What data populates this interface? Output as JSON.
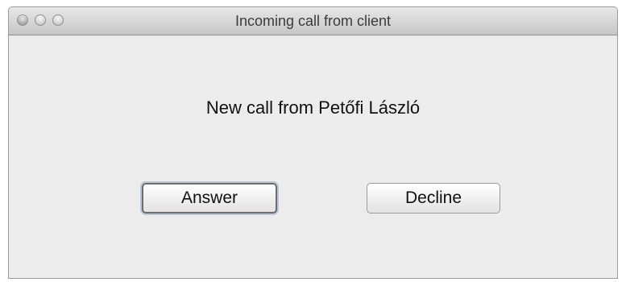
{
  "window": {
    "title": "Incoming call from client"
  },
  "titlebar": {
    "buttons": [
      {
        "name": "close-icon"
      },
      {
        "name": "minimize-icon"
      },
      {
        "name": "zoom-icon"
      }
    ]
  },
  "dialog": {
    "message": "New call from Petőfi László",
    "answer_label": "Answer",
    "decline_label": "Decline"
  }
}
